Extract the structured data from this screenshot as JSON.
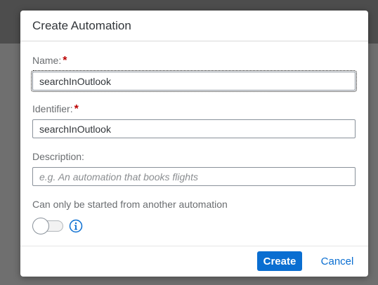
{
  "dialog": {
    "title": "Create Automation"
  },
  "form": {
    "name": {
      "label": "Name:",
      "required_mark": "*",
      "value": "searchInOutlook"
    },
    "identifier": {
      "label": "Identifier:",
      "required_mark": "*",
      "value": "searchInOutlook"
    },
    "description": {
      "label": "Description:",
      "value": "",
      "placeholder": "e.g. An automation that books flights"
    },
    "start_option": {
      "label": "Can only be started from another automation",
      "enabled": false,
      "info_icon": "info-icon"
    }
  },
  "footer": {
    "create_label": "Create",
    "cancel_label": "Cancel"
  },
  "colors": {
    "accent": "#0a6ed1",
    "required": "#bb0000"
  }
}
